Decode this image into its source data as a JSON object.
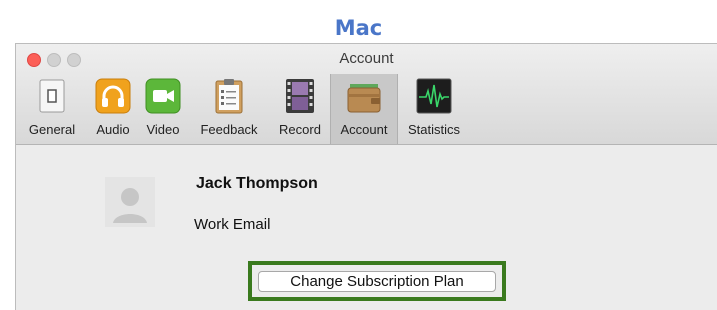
{
  "caption": "Mac",
  "window": {
    "title": "Account"
  },
  "toolbar": {
    "tabs": [
      {
        "label": "General",
        "icon": "switch-icon"
      },
      {
        "label": "Audio",
        "icon": "headphones-icon"
      },
      {
        "label": "Video",
        "icon": "video-camera-icon"
      },
      {
        "label": "Feedback",
        "icon": "clipboard-icon"
      },
      {
        "label": "Record",
        "icon": "film-icon"
      },
      {
        "label": "Account",
        "icon": "wallet-icon",
        "selected": true
      },
      {
        "label": "Statistics",
        "icon": "waveform-icon"
      }
    ]
  },
  "account": {
    "name": "Jack Thompson",
    "email": "Work Email",
    "change_plan_label": "Change Subscription Plan"
  },
  "colors": {
    "caption": "#4a76c8",
    "highlight": "#3a7a1e",
    "close": "#fc5f57"
  }
}
